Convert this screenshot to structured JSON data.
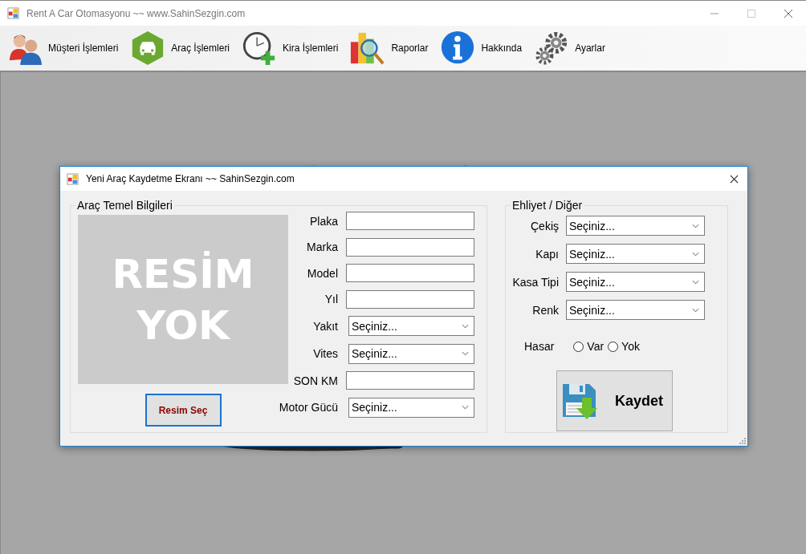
{
  "window": {
    "title": "Rent A Car Otomasyonu ~~ www.SahinSezgin.com"
  },
  "toolbar": [
    {
      "label": "Müşteri İşlemleri",
      "kind": "people"
    },
    {
      "label": "Araç İşlemleri",
      "kind": "car"
    },
    {
      "label": "Kira İşlemleri",
      "kind": "clock"
    },
    {
      "label": "Raporlar",
      "kind": "chart"
    },
    {
      "label": "Hakkında",
      "kind": "info"
    },
    {
      "label": "Ayarlar",
      "kind": "gears"
    }
  ],
  "dialog": {
    "title": "Yeni Araç Kaydetme Ekranı ~~ SahinSezgin.com",
    "basic_group": {
      "title": "Araç Temel Bilgileri",
      "image_text": [
        "RESİM",
        "YOK"
      ],
      "image_button": "Resim Seç",
      "fields": [
        {
          "label": "Plaka",
          "kind": "text"
        },
        {
          "label": "Marka",
          "kind": "text"
        },
        {
          "label": "Model",
          "kind": "text"
        },
        {
          "label": "Yıl",
          "kind": "text"
        },
        {
          "label": "Yakıt",
          "kind": "combo",
          "value": "Seçiniz..."
        },
        {
          "label": "Vites",
          "kind": "combo",
          "value": "Seçiniz..."
        },
        {
          "label": "SON KM",
          "kind": "text"
        },
        {
          "label": "Motor Gücü",
          "kind": "combo",
          "value": "Seçiniz..."
        }
      ]
    },
    "other_group": {
      "title": "Ehliyet / Diğer",
      "fields": [
        {
          "label": "Çekiş",
          "value": "Seçiniz..."
        },
        {
          "label": "Kapı",
          "value": "Seçiniz..."
        },
        {
          "label": "Kasa Tipi",
          "value": "Seçiniz..."
        },
        {
          "label": "Renk",
          "value": "Seçiniz..."
        }
      ],
      "damage": {
        "label": "Hasar",
        "options": [
          {
            "label": "Var",
            "selected": false
          },
          {
            "label": "Yok",
            "selected": false
          }
        ]
      },
      "save_button": "Kaydet"
    }
  }
}
